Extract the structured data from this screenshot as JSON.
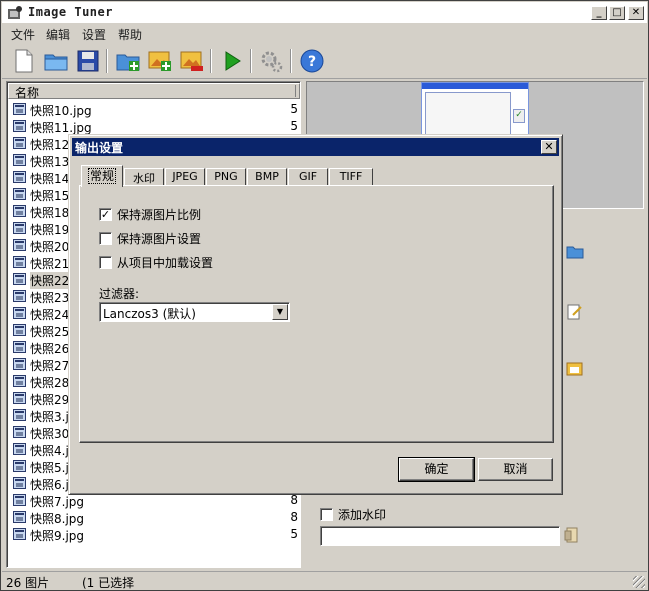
{
  "window": {
    "title": "Image Tuner"
  },
  "menu": [
    "文件",
    "编辑",
    "设置",
    "帮助"
  ],
  "toolbar": [
    "new-file-icon",
    "open-folder-icon",
    "save-icon",
    "add-folder-icon",
    "add-image-icon",
    "remove-image-icon",
    "run-icon",
    "settings-gear-icon",
    "help-icon"
  ],
  "list": {
    "header": "名称",
    "rows": [
      {
        "name": "快照10.jpg",
        "size": "5"
      },
      {
        "name": "快照11.jpg",
        "size": "5"
      },
      {
        "name": "快照12",
        "size": ""
      },
      {
        "name": "快照13",
        "size": ""
      },
      {
        "name": "快照14",
        "size": ""
      },
      {
        "name": "快照15",
        "size": ""
      },
      {
        "name": "快照18",
        "size": ""
      },
      {
        "name": "快照19",
        "size": ""
      },
      {
        "name": "快照20",
        "size": ""
      },
      {
        "name": "快照21",
        "size": ""
      },
      {
        "name": "快照22",
        "size": ""
      },
      {
        "name": "快照23",
        "size": ""
      },
      {
        "name": "快照24",
        "size": ""
      },
      {
        "name": "快照25",
        "size": ""
      },
      {
        "name": "快照26",
        "size": ""
      },
      {
        "name": "快照27",
        "size": ""
      },
      {
        "name": "快照28",
        "size": ""
      },
      {
        "name": "快照29",
        "size": ""
      },
      {
        "name": "快照3.j",
        "size": ""
      },
      {
        "name": "快照30",
        "size": ""
      },
      {
        "name": "快照4.j",
        "size": ""
      },
      {
        "name": "快照5.j",
        "size": ""
      },
      {
        "name": "快照6.j",
        "size": ""
      },
      {
        "name": "快照7.jpg",
        "size": "8"
      },
      {
        "name": "快照8.jpg",
        "size": "8"
      },
      {
        "name": "快照9.jpg",
        "size": "5"
      }
    ]
  },
  "watermark": {
    "label": "添加水印",
    "value": ""
  },
  "status": {
    "count": "26 图片",
    "selected": "(1 已选择"
  },
  "dialog": {
    "title": "输出设置",
    "tabs": [
      "常规",
      "水印",
      "JPEG",
      "PNG",
      "BMP",
      "GIF",
      "TIFF"
    ],
    "active_tab": "常规",
    "options": [
      {
        "label": "保持源图片比例",
        "checked": true
      },
      {
        "label": "保持源图片设置",
        "checked": false
      },
      {
        "label": "从项目中加载设置",
        "checked": false
      }
    ],
    "filter_label": "过滤器:",
    "filter_value": "Lanczos3 (默认)",
    "ok": "确定",
    "cancel": "取消"
  }
}
